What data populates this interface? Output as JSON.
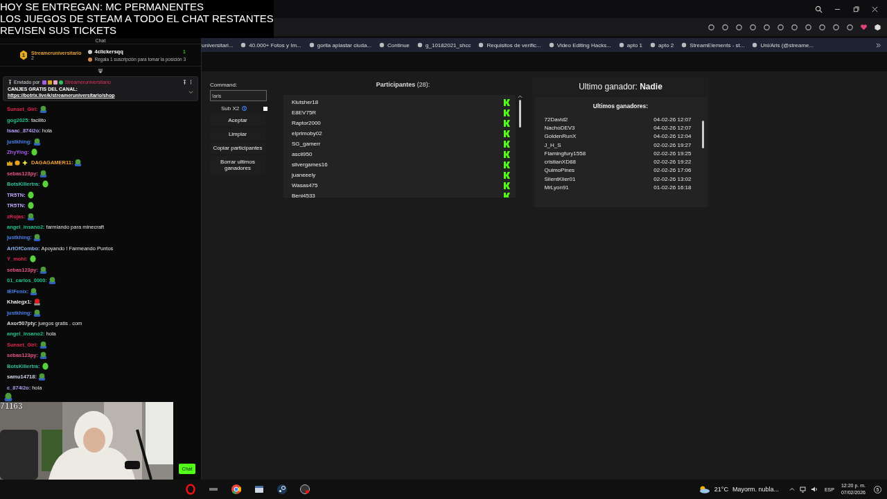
{
  "overlay": {
    "lines": [
      "HOY SE ENTREGAN: MC PERMANENTES",
      "LOS JUEGOS DE STEAM A TODO EL CHAT RESTANTES",
      "REVISEN SUS TICKETS"
    ]
  },
  "bookmarks": [
    "universitari...",
    "40.000+ Fotos y Im...",
    "gorila aplastar ciuda...",
    "Continue",
    "g_10182021_shcc",
    "Requisitos de verific...",
    "Video Editing Hacks...",
    "apto 1",
    "apto 2",
    "StreamElements - st...",
    "Uni/Aris (@streame..."
  ],
  "chat": {
    "title": "Chat",
    "ranking": {
      "first": {
        "rank": "1",
        "name": "Streameruniversitario",
        "count": "2"
      },
      "second": {
        "name": "4clickersqq",
        "count": "1"
      },
      "hint": "Regala 1 suscripción para tomar la posición 3"
    },
    "pinned": {
      "sent_by": "Enviado por",
      "author": "Streameruniversitario",
      "title": "CANJES GRATIS DEL CANAL:",
      "link": "https://botrix.live/k/streameruniversitario/shop"
    },
    "messages": [
      {
        "user": "Sunset_Girl:",
        "color": "#e0264e",
        "kind": "frog"
      },
      {
        "user": "gog2025:",
        "color": "#22c08a",
        "kind": "text",
        "text": "facilito"
      },
      {
        "user": "Isaac_874i2o:",
        "color": "#b49cf0",
        "kind": "text",
        "text": "hola"
      },
      {
        "user": "justkhing:",
        "color": "#4a82f0",
        "kind": "frog"
      },
      {
        "user": "ZhyYing:",
        "color": "#a65cf0",
        "kind": "blob"
      },
      {
        "user": "DAGAGAMER11:",
        "color": "#f0a030",
        "kind": "frog",
        "badges": true
      },
      {
        "user": "sebas123py:",
        "color": "#e8558a",
        "kind": "frog"
      },
      {
        "user": "BotsKillertra:",
        "color": "#2fc09a",
        "kind": "blob"
      },
      {
        "user": "TR5TN:",
        "color": "#c0a8ff",
        "kind": "blob"
      },
      {
        "user": "TR5TN:",
        "color": "#c0a8ff",
        "kind": "blob"
      },
      {
        "user": "zRojas:",
        "color": "#e0264e",
        "kind": "frog"
      },
      {
        "user": "angel_insano2:",
        "color": "#22c08a",
        "kind": "text",
        "text": "farmiando para minecraft"
      },
      {
        "user": "justkhing:",
        "color": "#4a82f0",
        "kind": "frog"
      },
      {
        "user": "ArtOfCombo:",
        "color": "#8ab4f0",
        "kind": "text",
        "text": "Apoyando ! Farmeando Puntos"
      },
      {
        "user": "Y_mohi:",
        "color": "#e0264e",
        "kind": "blob"
      },
      {
        "user": "sebas123py:",
        "color": "#e8558a",
        "kind": "frog"
      },
      {
        "user": "01_carlos_0000:",
        "color": "#22c08a",
        "kind": "frog"
      },
      {
        "user": "iElFenix:",
        "color": "#4a82f0",
        "kind": "frog"
      },
      {
        "user": "Khalegx1:",
        "color": "#e8e8e8",
        "kind": "red"
      },
      {
        "user": "justkhing:",
        "color": "#4a82f0",
        "kind": "frog"
      },
      {
        "user": "Axor507pty:",
        "color": "#dcdcdc",
        "kind": "text",
        "text": "juegos gratis . com"
      },
      {
        "user": "angel_insano2:",
        "color": "#22c08a",
        "kind": "text",
        "text": "hola"
      },
      {
        "user": "Sunset_Girl:",
        "color": "#e0264e",
        "kind": "frog"
      },
      {
        "user": "sebas123py:",
        "color": "#e8558a",
        "kind": "frog"
      },
      {
        "user": "BotsKillertra:",
        "color": "#2fc09a",
        "kind": "blob"
      },
      {
        "user": "samu14718:",
        "color": "#d0d8ec",
        "kind": "frog"
      },
      {
        "user": "c_874i2o:",
        "color": "#b49cf0",
        "kind": "text",
        "text": "hola"
      }
    ],
    "viewers": "71163",
    "chat_button": "Chat"
  },
  "controls": {
    "command_label": "Command:",
    "command_value": "!aris",
    "sub_label": "Sub X2",
    "sub_checked": false,
    "buttons": [
      "Aceptar",
      "Limpiar",
      "Copiar participantes",
      "Borrar ultimos ganadores"
    ]
  },
  "participants": {
    "title": "**Participantes** (28):",
    "names": [
      "Klutsher18",
      "E8EV75R",
      "Raptor2000",
      "elprimoby02",
      "SG_gamerr",
      "ascii950",
      "silvergames16",
      "juaneeely",
      "Wasas475",
      "Beni4533"
    ]
  },
  "winner": {
    "title": "Ultimo ganador: **Nadie**",
    "list_title": "Ultimos ganadores:",
    "rows": [
      {
        "name": "72David2",
        "date": "04-02-26 12:07"
      },
      {
        "name": "NachoDEV3",
        "date": "04-02-26 12:07"
      },
      {
        "name": "GoldenRunX",
        "date": "04-02-26 12:04"
      },
      {
        "name": "J_H_S",
        "date": "02-02-26 19:27"
      },
      {
        "name": "Flamingfury1558",
        "date": "02-02-26 19:25"
      },
      {
        "name": "cristianXD88",
        "date": "02-02-26 19:22"
      },
      {
        "name": "QuimoPines",
        "date": "02-02-26 17:06"
      },
      {
        "name": "SilentKiler01",
        "date": "02-02-26 13:02"
      },
      {
        "name": "MrLyon91",
        "date": "01-02-26 16:18"
      }
    ]
  },
  "taskbar": {
    "temperature": "21°C",
    "weather": "Mayorm. nubla...",
    "language": "ESP",
    "time": "12:20 p. m.",
    "date": "07/02/2026",
    "notifications": "5"
  }
}
